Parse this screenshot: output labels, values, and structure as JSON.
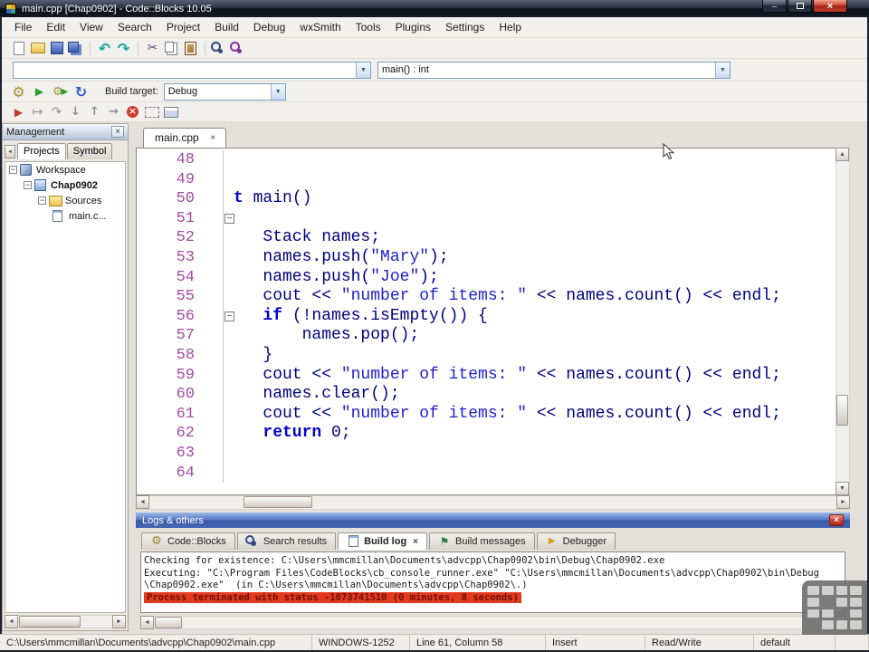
{
  "colors": {
    "code_text": "#000080",
    "keyword": "#0000d0",
    "string": "#2121cc",
    "line_number": "#a349a4",
    "error_highlight_bg": "#e23a1e",
    "error_highlight_text": "#701008",
    "logs_header": "#4466b0"
  },
  "window": {
    "title": "main.cpp [Chap0902] - Code::Blocks 10.05"
  },
  "menu": {
    "items": [
      "File",
      "Edit",
      "View",
      "Search",
      "Project",
      "Build",
      "Debug",
      "wxSmith",
      "Tools",
      "Plugins",
      "Settings",
      "Help"
    ]
  },
  "toolbar": {
    "main_icon_groups": [
      [
        "new-file",
        "open-file",
        "save",
        "save-all"
      ],
      [
        "undo",
        "redo"
      ],
      [
        "cut",
        "copy",
        "paste"
      ],
      [
        "find",
        "replace"
      ]
    ],
    "compiler_icons": [
      "build",
      "run",
      "build-and-run",
      "rebuild"
    ],
    "debug_icons": [
      "debug-continue",
      "run-to-cursor",
      "next-line",
      "step-into",
      "step-out",
      "next-instruction",
      "stop-debugger",
      "info-window",
      "debugging-windows"
    ],
    "scope_combo_value": "",
    "symbol_combo_value": "main() : int",
    "build_target_label": "Build target:",
    "build_target_value": "Debug"
  },
  "management": {
    "title": "Management",
    "tabs": [
      "Projects",
      "Symbol"
    ],
    "active_tab": "Projects",
    "tree": [
      {
        "label": "Workspace",
        "level": 0,
        "icon": "workspace",
        "bold": false,
        "expandable": true
      },
      {
        "label": "Chap0902",
        "level": 1,
        "icon": "project",
        "bold": true,
        "expandable": true
      },
      {
        "label": "Sources",
        "level": 2,
        "icon": "folder",
        "bold": false,
        "expandable": true
      },
      {
        "label": "main.c...",
        "level": 3,
        "icon": "file",
        "bold": false,
        "expandable": false
      }
    ]
  },
  "editor": {
    "tab_label": "main.cpp",
    "lines": [
      {
        "num": 48,
        "segs": []
      },
      {
        "num": 49,
        "segs": []
      },
      {
        "num": 50,
        "segs": [
          {
            "t": "t",
            "c": "kw"
          },
          {
            "t": " main()",
            "c": "code"
          }
        ]
      },
      {
        "num": 51,
        "fold": true,
        "segs": []
      },
      {
        "num": 52,
        "segs": [
          {
            "t": "   Stack names;",
            "c": "code"
          }
        ]
      },
      {
        "num": 53,
        "segs": [
          {
            "t": "   names.push(",
            "c": "code"
          },
          {
            "t": "\"Mary\"",
            "c": "str"
          },
          {
            "t": ");",
            "c": "code"
          }
        ]
      },
      {
        "num": 54,
        "segs": [
          {
            "t": "   names.push(",
            "c": "code"
          },
          {
            "t": "\"Joe\"",
            "c": "str"
          },
          {
            "t": ");",
            "c": "code"
          }
        ]
      },
      {
        "num": 55,
        "segs": [
          {
            "t": "   cout << ",
            "c": "code"
          },
          {
            "t": "\"number of items: \"",
            "c": "str"
          },
          {
            "t": " << names.count() << endl;",
            "c": "code"
          }
        ]
      },
      {
        "num": 56,
        "fold": true,
        "segs": [
          {
            "t": "   ",
            "c": "code"
          },
          {
            "t": "if",
            "c": "kw"
          },
          {
            "t": " (!names.isEmpty()) {",
            "c": "code"
          }
        ]
      },
      {
        "num": 57,
        "segs": [
          {
            "t": "       names.pop();",
            "c": "code"
          }
        ]
      },
      {
        "num": 58,
        "segs": [
          {
            "t": "   }",
            "c": "code"
          }
        ]
      },
      {
        "num": 59,
        "segs": [
          {
            "t": "   cout << ",
            "c": "code"
          },
          {
            "t": "\"number of items: \"",
            "c": "str"
          },
          {
            "t": " << names.count() << endl;",
            "c": "code"
          }
        ]
      },
      {
        "num": 60,
        "segs": [
          {
            "t": "   names.clear();",
            "c": "code"
          }
        ]
      },
      {
        "num": 61,
        "segs": [
          {
            "t": "   cout << ",
            "c": "code"
          },
          {
            "t": "\"number of items: \"",
            "c": "str"
          },
          {
            "t": " << names.count() << endl;",
            "c": "code"
          }
        ]
      },
      {
        "num": 62,
        "segs": [
          {
            "t": "   ",
            "c": "code"
          },
          {
            "t": "return",
            "c": "kw"
          },
          {
            "t": " 0;",
            "c": "code"
          }
        ]
      },
      {
        "num": 63,
        "segs": []
      },
      {
        "num": 64,
        "segs": []
      }
    ]
  },
  "logs": {
    "title": "Logs & others",
    "tabs": [
      {
        "label": "Code::Blocks",
        "icon": "gear",
        "active": false,
        "closable": false
      },
      {
        "label": "Search results",
        "icon": "search",
        "active": false,
        "closable": false
      },
      {
        "label": "Build log",
        "icon": "log",
        "active": true,
        "closable": true
      },
      {
        "label": "Build messages",
        "icon": "flag",
        "active": false,
        "closable": false
      },
      {
        "label": "Debugger",
        "icon": "debug",
        "active": false,
        "closable": false
      }
    ],
    "lines": [
      {
        "text": "Checking for existence: C:\\Users\\mmcmillan\\Documents\\advcpp\\Chap0902\\bin\\Debug\\Chap0902.exe",
        "error": false
      },
      {
        "text": "Executing: \"C:\\Program Files\\CodeBlocks\\cb_console_runner.exe\" \"C:\\Users\\mmcmillan\\Documents\\advcpp\\Chap0902\\bin\\Debug",
        "error": false
      },
      {
        "text": "\\Chap0902.exe\"  (in C:\\Users\\mmcmillan\\Documents\\advcpp\\Chap0902\\.)",
        "error": false
      },
      {
        "text": "Process terminated with status -1073741510 (0 minutes, 8 seconds)",
        "error": true
      }
    ]
  },
  "statusbar": {
    "fields": [
      "C:\\Users\\mmcmillan\\Documents\\advcpp\\Chap0902\\main.cpp",
      "WINDOWS-1252",
      "Line 61, Column 58",
      "Insert",
      "Read/Write",
      "default"
    ]
  }
}
